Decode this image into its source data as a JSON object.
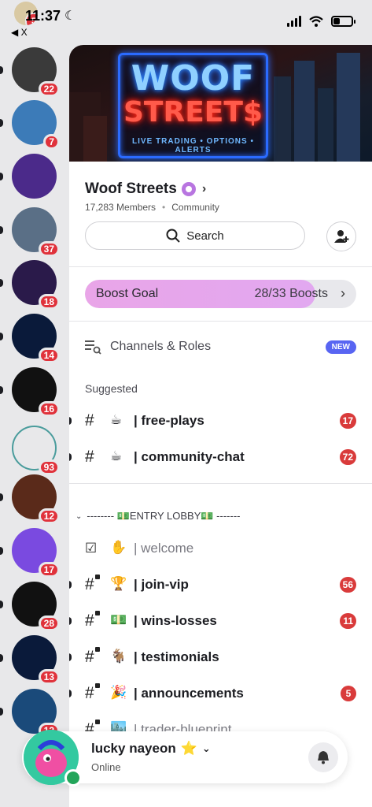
{
  "status_bar": {
    "time": "11:37",
    "back_label": "◀ X",
    "top_badge": "5"
  },
  "servers": [
    {
      "badge": "22",
      "color": "#3a3a3a",
      "unread": true
    },
    {
      "badge": "7",
      "color": "#3c7bb8",
      "unread": true
    },
    {
      "badge": "",
      "color": "#4b2a8a",
      "unread": true
    },
    {
      "badge": "37",
      "color": "#5a6f86",
      "unread": true
    },
    {
      "badge": "18",
      "color": "#2a1a4a",
      "unread": true
    },
    {
      "badge": "14",
      "color": "#0a1a3a",
      "unread": true
    },
    {
      "badge": "16",
      "color": "#111111",
      "unread": true
    },
    {
      "badge": "93",
      "color": "#e8e8ea",
      "unread": false
    },
    {
      "badge": "12",
      "color": "#5a2a1a",
      "unread": true
    },
    {
      "badge": "17",
      "color": "#7a4ae0",
      "unread": true
    },
    {
      "badge": "28",
      "color": "#111111",
      "unread": true
    },
    {
      "badge": "13",
      "color": "#0a1a3a",
      "unread": true
    },
    {
      "badge": "12",
      "color": "#1a4a7a",
      "unread": true
    }
  ],
  "banner": {
    "line1": "WOOF",
    "line2": "STREET$",
    "tagline": "LIVE TRADING • OPTIONS • ALERTS"
  },
  "server_info": {
    "name": "Woof Streets",
    "members": "17,283 Members",
    "type": "Community"
  },
  "search": {
    "label": "Search"
  },
  "boost": {
    "label": "Boost Goal",
    "count": "28/33 Boosts",
    "progress": 0.848
  },
  "channels_roles": {
    "label": "Channels & Roles",
    "badge": "NEW"
  },
  "suggested": {
    "heading": "Suggested",
    "items": [
      {
        "emoji": "☕",
        "name": "| free-plays",
        "badge": "17"
      },
      {
        "emoji": "☕",
        "name": "| community-chat",
        "badge": "72"
      }
    ]
  },
  "category": {
    "name": "-------- 💵ENTRY LOBBY💵 -------"
  },
  "lobby": [
    {
      "emoji": "✋",
      "name": "| welcome",
      "badge": "",
      "locked": false,
      "read": true,
      "icon": "rules-icon"
    },
    {
      "emoji": "🏆",
      "name": "| join-vip",
      "badge": "56",
      "locked": true,
      "read": false,
      "icon": "hash-lock-icon"
    },
    {
      "emoji": "💵",
      "name": "| wins-losses",
      "badge": "11",
      "locked": true,
      "read": false,
      "icon": "hash-lock-icon"
    },
    {
      "emoji": "🐐",
      "name": "| testimonials",
      "badge": "",
      "locked": true,
      "read": false,
      "icon": "hash-lock-icon"
    },
    {
      "emoji": "🎉",
      "name": "| announcements",
      "badge": "5",
      "locked": true,
      "read": false,
      "icon": "hash-lock-icon"
    },
    {
      "emoji": "🏙️",
      "name": "| trader-blueprint",
      "badge": "",
      "locked": true,
      "read": true,
      "icon": "hash-lock-icon"
    }
  ],
  "user": {
    "name": "lucky nayeon",
    "status": "Online",
    "badge_emoji": "⭐"
  },
  "colors": {
    "accent": "#5865f2",
    "badge_red": "#e0323b",
    "online": "#23a55a",
    "boost_fill": "#e9a5e8"
  }
}
